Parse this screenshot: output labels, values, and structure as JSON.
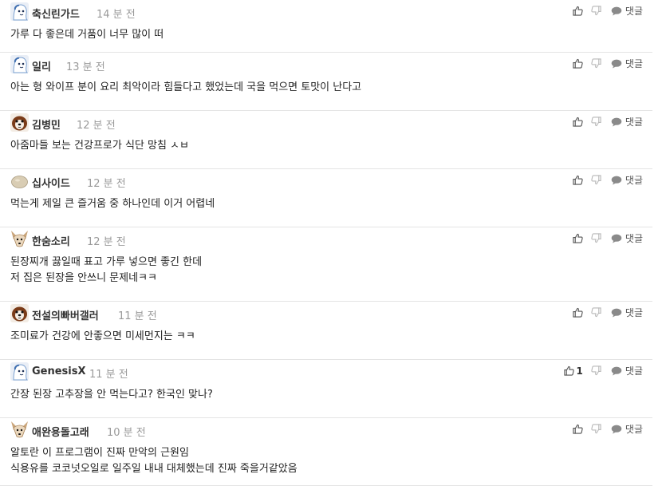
{
  "comments": [
    {
      "avatar": "ghost-avatar",
      "author": "축신린가드",
      "time": "14 분 전",
      "lines": [
        "가루 다 좋은데 거품이 너무 많이 떠"
      ],
      "likes": "",
      "reply": "댓글"
    },
    {
      "avatar": "ghost-avatar",
      "author": "일리",
      "time": "13 분 전",
      "lines": [
        "아는 형 와이프 분이 요리 최악이라 힘들다고 했었는데 국을 먹으면 토맛이 난다고"
      ],
      "likes": "",
      "reply": "댓글"
    },
    {
      "avatar": "dog-avatar",
      "author": "김병민",
      "time": "12 분 전",
      "lines": [
        "아줌마들 보는 건강프로가 식단 망침 ㅅㅂ"
      ],
      "likes": "",
      "reply": "댓글"
    },
    {
      "avatar": "blob-avatar",
      "author": "십사이드",
      "time": "12 분 전",
      "lines": [
        "먹는게 제일 큰 즐거움 중 하나인데 이거 어렵네"
      ],
      "likes": "",
      "reply": "댓글"
    },
    {
      "avatar": "fox-avatar",
      "author": "한숨소리",
      "time": "12 분 전",
      "lines": [
        "된장찌개 끓일때 표고 가루 넣으면 좋긴 한데",
        "저 집은 된장을 안쓰니 문제네ㅋㅋ"
      ],
      "likes": "",
      "reply": "댓글"
    },
    {
      "avatar": "dog-avatar",
      "author": "전설의빠버갤러",
      "time": "11 분 전",
      "lines": [
        "조미료가 건강에 안좋으면 미세먼지는 ㅋㅋ"
      ],
      "likes": "",
      "reply": "댓글"
    },
    {
      "avatar": "ghost-avatar",
      "author": "GenesisX",
      "time": "11 분 전",
      "lines": [
        "간장 된장 고추장을 안 먹는다고? 한국인 맞나?"
      ],
      "likes": "1",
      "reply": "댓글"
    },
    {
      "avatar": "fox-avatar",
      "author": "애완용돌고래",
      "time": "10 분 전",
      "lines": [
        "알토란 이 프로그램이 진짜 만악의 근원임",
        "식용유를 코코넛오일로 일주일 내내 대체했는데 진짜 죽을거같았음"
      ],
      "likes": "",
      "reply": "댓글"
    }
  ]
}
